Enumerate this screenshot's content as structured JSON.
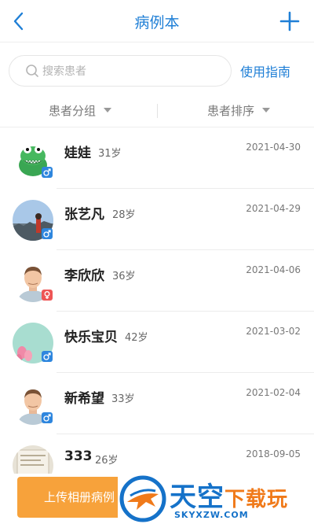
{
  "header": {
    "title": "病例本",
    "back_icon": "chevron-left-icon",
    "add_icon": "plus-icon",
    "accent_color": "#1f7fd6"
  },
  "search": {
    "placeholder": "搜索患者",
    "value": "",
    "guide_label": "使用指南"
  },
  "filters": {
    "group_label": "患者分组",
    "sort_label": "患者排序"
  },
  "patients": [
    {
      "name": "娃娃",
      "age": "31岁",
      "date": "2021-04-30",
      "gender": "male",
      "avatar": "green-monster-avatar"
    },
    {
      "name": "张艺凡",
      "age": "28岁",
      "date": "2021-04-29",
      "gender": "male",
      "avatar": "landscape-photo-avatar"
    },
    {
      "name": "李欣欣",
      "age": "36岁",
      "date": "2021-04-06",
      "gender": "female",
      "avatar": "default-male-avatar"
    },
    {
      "name": "快乐宝贝",
      "age": "42岁",
      "date": "2021-03-02",
      "gender": "male",
      "avatar": "pink-tulips-avatar"
    },
    {
      "name": "新希望",
      "age": "33岁",
      "date": "2021-02-04",
      "gender": "male",
      "avatar": "default-male-avatar"
    },
    {
      "name": "333",
      "age": "26岁",
      "date": "2018-09-05",
      "gender": "male",
      "avatar": "document-photo-avatar"
    }
  ],
  "bottom": {
    "upload_label": "上传相册病例"
  },
  "watermark": {
    "title_main": "天空",
    "title_accent": "下载玩",
    "url": "SKYXZW.COM"
  }
}
